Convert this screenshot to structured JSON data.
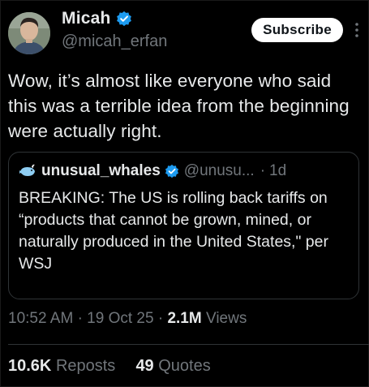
{
  "author": {
    "display_name": "Micah",
    "handle": "@micah_erfan",
    "verified_icon": "verified-badge-icon"
  },
  "actions": {
    "subscribe_label": "Subscribe",
    "more_icon": "more-vertical-icon"
  },
  "tweet": {
    "text": "Wow, it’s almost like everyone who said this was a terrible idea from the beginning were actually right."
  },
  "quote": {
    "avatar_icon": "whale-avatar-icon",
    "display_name": "unusual_whales",
    "handle": "@unusu...",
    "separator": "·",
    "time": "1d",
    "text": "BREAKING: The US is rolling back tariffs on “products that cannot be grown, mined, or naturally produced in the United States,\" per WSJ"
  },
  "meta": {
    "time": "10:52 AM",
    "sep1": "·",
    "date": "19 Oct 25",
    "sep2": "·",
    "views_count": "2.1M",
    "views_label": "Views"
  },
  "stats": {
    "reposts_count": "10.6K",
    "reposts_label": "Reposts",
    "quotes_count": "49",
    "quotes_label": "Quotes"
  },
  "colors": {
    "background": "#000000",
    "text": "#e7e9ea",
    "muted": "#71767b",
    "verified": "#1d9bf0",
    "border": "#2f3336"
  }
}
